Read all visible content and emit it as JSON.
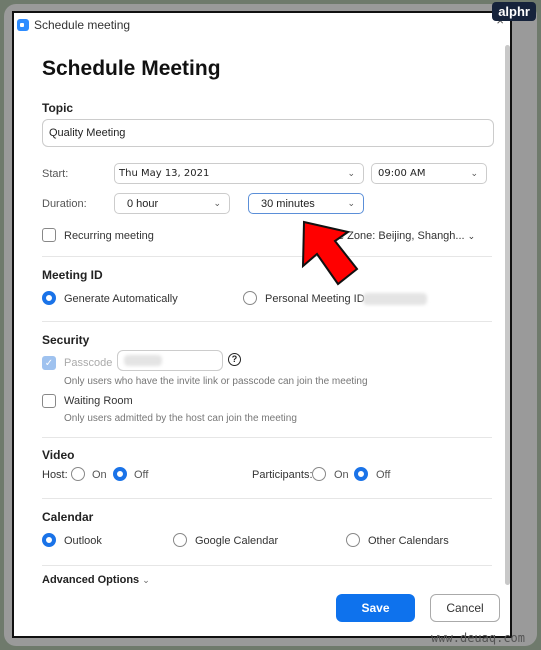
{
  "window": {
    "title": "Schedule meeting",
    "close": "×"
  },
  "heading": "Schedule Meeting",
  "topic": {
    "label": "Topic",
    "value": "Quality Meeting"
  },
  "start": {
    "label": "Start:",
    "date": "Thu  May  13, 2021",
    "time": "09:00  AM"
  },
  "duration": {
    "label": "Duration:",
    "hours": "0 hour",
    "minutes": "30 minutes"
  },
  "recurring": {
    "label": "Recurring meeting",
    "checked": false
  },
  "timezone": {
    "label": "e Zone: Beijing, Shangh..."
  },
  "meeting_id": {
    "label": "Meeting ID",
    "options": [
      {
        "label": "Generate Automatically",
        "selected": true
      },
      {
        "label": "Personal Meeting ID",
        "selected": false
      }
    ]
  },
  "security": {
    "label": "Security",
    "passcode": {
      "label": "Passcode",
      "checked": true,
      "disabled": true,
      "help": "?",
      "desc": "Only users who have the invite link or passcode can join the meeting"
    },
    "waiting_room": {
      "label": "Waiting Room",
      "checked": false,
      "desc": "Only users admitted by the host can join the meeting"
    }
  },
  "video": {
    "label": "Video",
    "host": {
      "label": "Host:",
      "on": "On",
      "off": "Off",
      "value": "Off"
    },
    "participants": {
      "label": "Participants:",
      "on": "On",
      "off": "Off",
      "value": "Off"
    }
  },
  "calendar": {
    "label": "Calendar",
    "options": [
      {
        "label": "Outlook",
        "selected": true
      },
      {
        "label": "Google Calendar",
        "selected": false
      },
      {
        "label": "Other Calendars",
        "selected": false
      }
    ]
  },
  "advanced": {
    "label": "Advanced Options",
    "chevron": "⌄"
  },
  "buttons": {
    "save": "Save",
    "cancel": "Cancel"
  },
  "watermarks": {
    "badge": "alphr",
    "site": "www.deuaq.com"
  },
  "colors": {
    "accent": "#0e72ed",
    "arrow": "#ff0000"
  }
}
